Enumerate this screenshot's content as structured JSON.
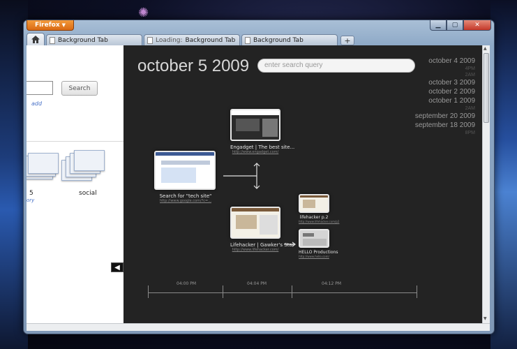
{
  "browser": {
    "menu_button_label": "Firefox",
    "window_controls": {
      "minimize": "▁",
      "maximize": "▢",
      "close": "✕"
    },
    "tabs": [
      {
        "label": "Background Tab",
        "loading_prefix": ""
      },
      {
        "label": "Background Tab",
        "loading_prefix": "Loading:"
      },
      {
        "label": "Background Tab",
        "loading_prefix": ""
      }
    ],
    "new_tab_label": "+"
  },
  "left_panel": {
    "search_button_label": "Search",
    "add_link_label": "add",
    "groups": [
      {
        "label": "5",
        "sublabel": "ory"
      },
      {
        "label": "social",
        "sublabel": ""
      }
    ]
  },
  "timeline": {
    "current_date": "october 5 2009",
    "search_placeholder": "enter search query",
    "date_list": [
      {
        "date": "october 4 2009",
        "times": [
          "4PM",
          "2AM"
        ]
      },
      {
        "date": "october 3 2009",
        "times": []
      },
      {
        "date": "october 2 2009",
        "times": []
      },
      {
        "date": "october 1 2009",
        "times": [
          "2AM"
        ]
      },
      {
        "date": "september 20 2009",
        "times": []
      },
      {
        "date": "september 18 2009",
        "times": [
          "8PM"
        ]
      }
    ],
    "nodes": {
      "search": {
        "title": "Search for \"tech site\"",
        "url": "http://www.google.com/?c=..."
      },
      "engadget": {
        "title": "Engadget | The best site...",
        "url": "http://www.engadget.com/"
      },
      "lifehacker": {
        "title": "Lifehacker | Gawker's Star",
        "url": "http://www.lifehacker.com/"
      },
      "lifehacker_p2": {
        "title": "lifehacker p.2",
        "url": "http://www.lifehacker.com/p2"
      },
      "hello": {
        "title": "HELLO Productions",
        "url": "http://www.hello.com/"
      }
    },
    "axis_labels": [
      "04:00 PM",
      "04:04 PM",
      "04:12 PM"
    ]
  }
}
